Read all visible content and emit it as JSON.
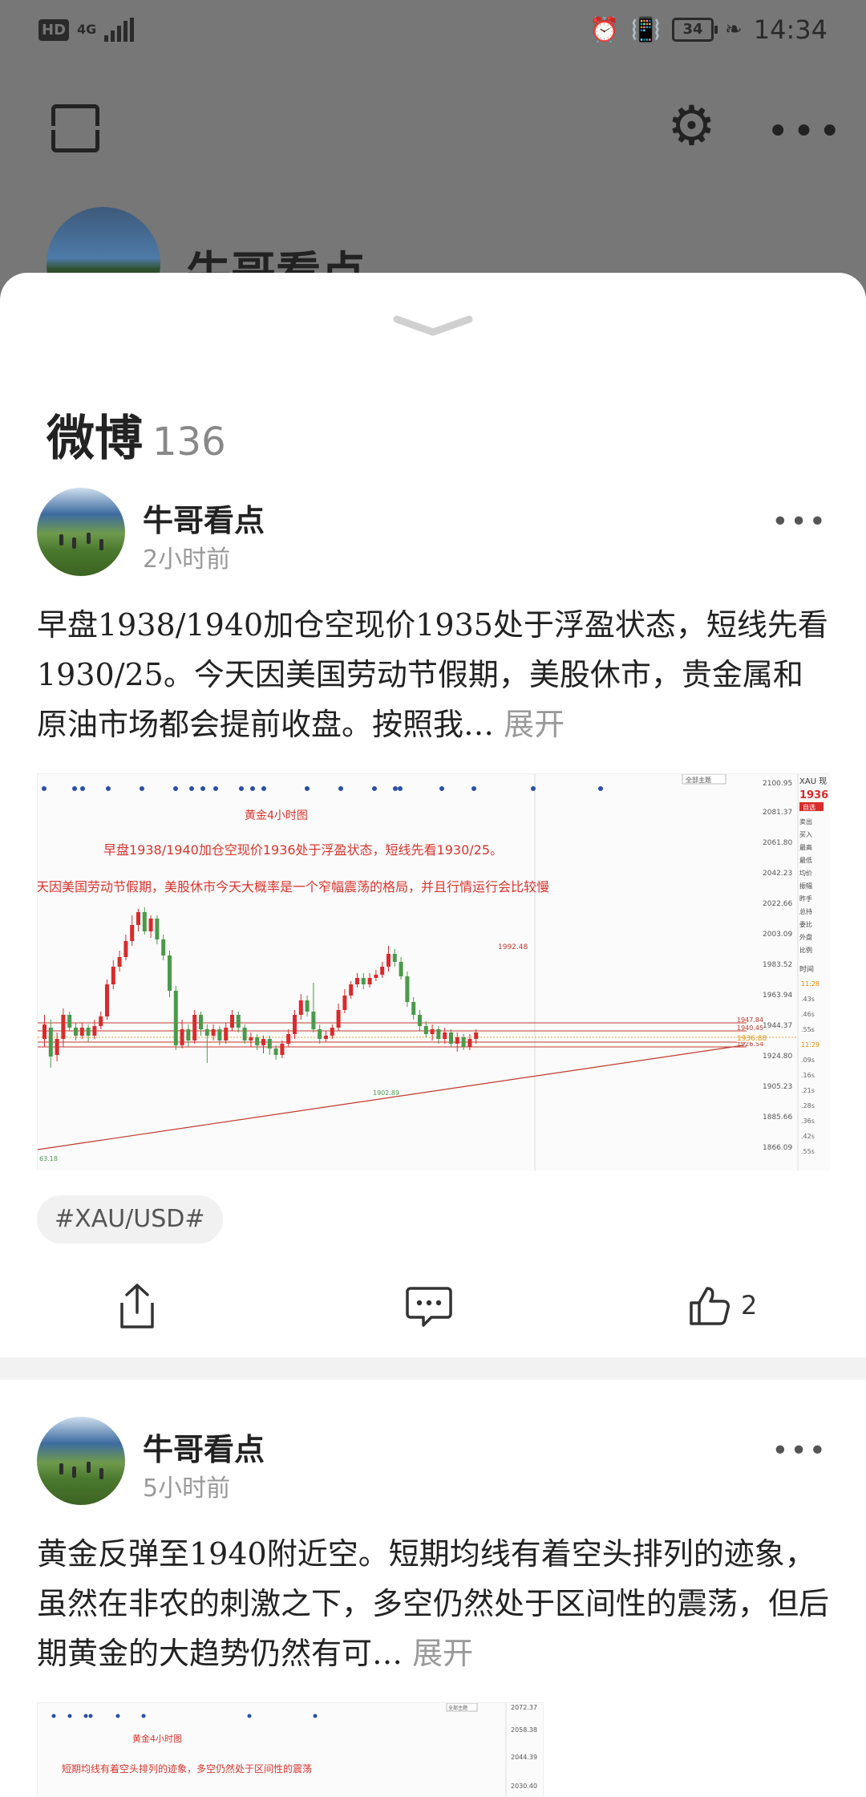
{
  "status_bar": {
    "hd": "HD",
    "network": "4G",
    "battery": "34",
    "time": "14:34"
  },
  "background": {
    "profile_name": "牛哥看点"
  },
  "sheet": {
    "title": "微博",
    "count": "136"
  },
  "posts": [
    {
      "author": "牛哥看点",
      "time": "2小时前",
      "text": "早盘1938/1940加仓空现价1935处于浮盈状态，短线先看1930/25。今天因美国劳动节假期，美股休市，贵金属和原油市场都会提前收盘。按照我…",
      "expand": "展开",
      "image": {
        "chart_title": "黄金4小时图",
        "line1": "早盘1938/1940加仓空现价1936处于浮盈状态，短线先看1930/25。",
        "line2": "天因美国劳动节假期，美股休市今天大概率是一个窄幅震荡的格局，并且行情运行会比较慢",
        "peak_label": "1992.48",
        "low_label": "1902.89",
        "corner_label": "63.18",
        "axis_labels": [
          "2100.95",
          "2081.37",
          "2061.80",
          "2042.23",
          "2022.66",
          "2003.09",
          "1983.52",
          "1963.94",
          "1944.37",
          "1924.80",
          "1905.23",
          "1885.66",
          "1866.09"
        ],
        "level_labels": [
          "1947.84",
          "1940.45",
          "1930.63",
          "1926.54"
        ],
        "current_price": "1936.88",
        "side_title": "XAU 现",
        "side_price": "1936",
        "side_badge": "自选",
        "side_items": [
          "卖出",
          "买入",
          "最高",
          "最低",
          "均价",
          "振幅",
          "昨手",
          "总持",
          "委比",
          "外盘",
          "比例"
        ],
        "side_time_label": "时间",
        "side_times": [
          "11:28",
          ".43s",
          ".46s",
          ".55s",
          "11:29",
          ".09s",
          ".16s",
          ".21s",
          ".28s",
          ".36s",
          ".42s",
          ".55s"
        ],
        "top_button": "全部主题"
      },
      "tag": "#XAU/USD#",
      "likes": "2"
    },
    {
      "author": "牛哥看点",
      "time": "5小时前",
      "text": "黄金反弹至1940附近空。短期均线有着空头排列的迹象，虽然在非农的刺激之下，多空仍然处于区间性的震荡，但后期黄金的大趋势仍然有可…",
      "expand": "展开",
      "image": {
        "chart_title": "黄金4小时图",
        "line1": "短期均线有着空头排列的迹象，多空仍然处于区间性的震荡",
        "axis_labels": [
          "2072.37",
          "2058.38",
          "2044.39",
          "2030.40"
        ],
        "top_button": "全部主题"
      }
    }
  ],
  "colors": {
    "bull": "#d92b2b",
    "bear": "#4a9a4a",
    "level_line": "#c0392b",
    "accent_text": "#d9342b",
    "muted": "#999999"
  }
}
